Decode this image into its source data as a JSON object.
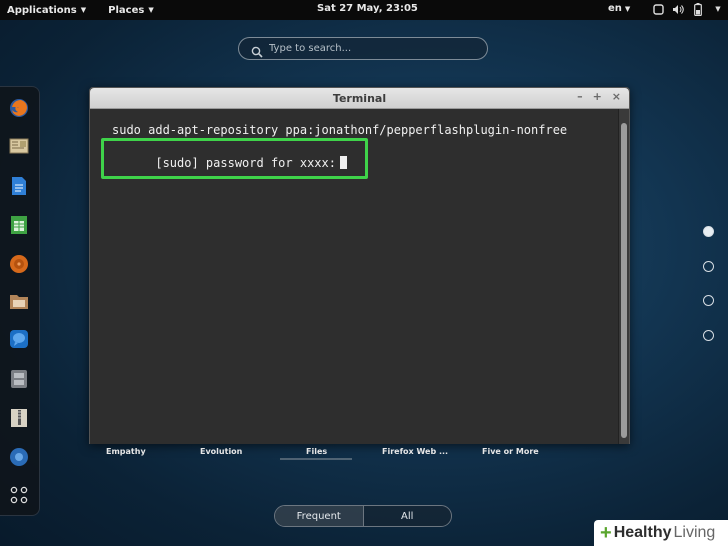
{
  "topbar": {
    "applications_label": "Applications",
    "places_label": "Places",
    "clock": "Sat 27 May, 23:05",
    "language": "en"
  },
  "search": {
    "placeholder": "Type to search..."
  },
  "terminal": {
    "title": "Terminal",
    "line1": "sudo add-apt-repository ppa:jonathonf/pepperflashplugin-nonfree",
    "line2": "[sudo] password for xxxx:"
  },
  "apps": [
    "Empathy",
    "Evolution",
    "Files",
    "Firefox Web ...",
    "Five or More"
  ],
  "view_selector": {
    "frequent": "Frequent",
    "all": "All"
  },
  "pager": {
    "pages": 4,
    "active_page": 1
  },
  "watermark": {
    "healthy": "Healthy",
    "living": "Living"
  },
  "colors": {
    "highlight": "#3fd34a",
    "background": "#123450"
  },
  "dash_icons": [
    "firefox-icon",
    "mail-icon",
    "documents-icon",
    "spreadsheet-icon",
    "music-icon",
    "files-icon",
    "chat-icon",
    "disk-icon",
    "archive-icon",
    "help-icon",
    "show-apps-icon"
  ]
}
